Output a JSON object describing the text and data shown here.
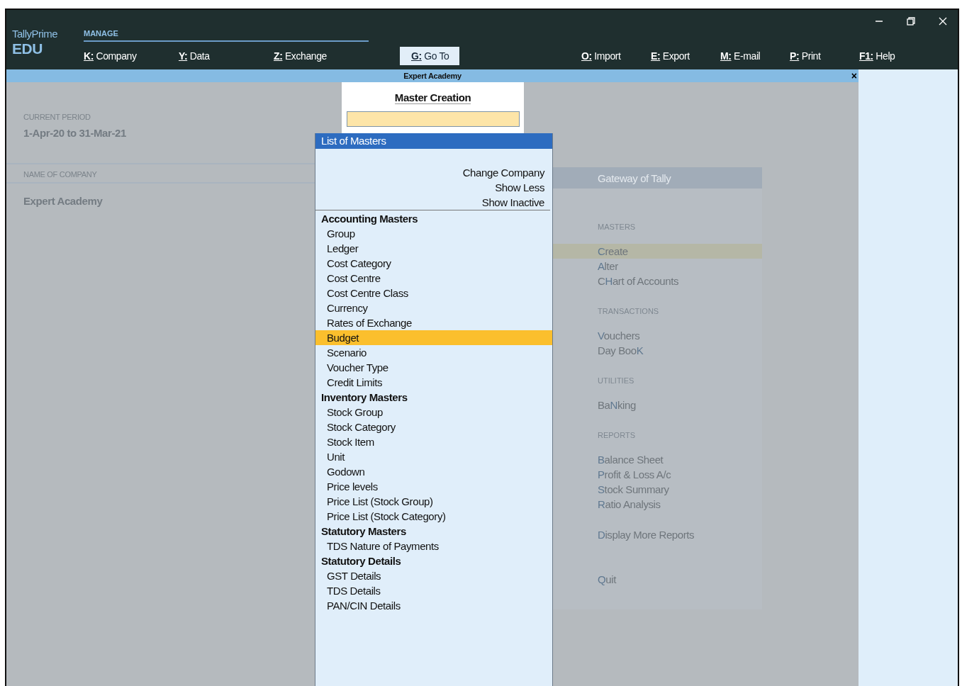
{
  "product": {
    "name": "TallyPrime",
    "edition": "EDU"
  },
  "menu_group": "MANAGE",
  "menu_left": [
    {
      "key": "K:",
      "label": "Company"
    },
    {
      "key": "Y:",
      "label": "Data"
    },
    {
      "key": "Z:",
      "label": "Exchange"
    }
  ],
  "goto_button": {
    "key": "G:",
    "label": "Go To"
  },
  "menu_right": [
    {
      "key": "O:",
      "label": "Import"
    },
    {
      "key": "E:",
      "label": "Export"
    },
    {
      "key": "M:",
      "label": "E-mail"
    },
    {
      "key": "P:",
      "label": "Print"
    },
    {
      "key": "F1:",
      "label": "Help"
    }
  ],
  "company_bar": {
    "title": "Expert Academy",
    "close": "×"
  },
  "info": [
    {
      "label": "CURRENT PERIOD",
      "value": "1-Apr-20 to 31-Mar-21"
    },
    {
      "label": "NAME OF COMPANY",
      "value": "Expert Academy"
    }
  ],
  "gateway": {
    "title": "Gateway of Tally",
    "sections": [
      {
        "title": "MASTERS",
        "items": [
          {
            "key": "C",
            "after": "reate",
            "selected": true
          },
          {
            "key": "A",
            "after": "lter",
            "selected": false
          },
          {
            "before": "C",
            "key": "H",
            "after": "art of Accounts",
            "selected": false
          }
        ]
      },
      {
        "title": "TRANSACTIONS",
        "items": [
          {
            "key": "V",
            "after": "ouchers",
            "selected": false
          },
          {
            "before": "Day Boo",
            "key": "K",
            "selected": false
          }
        ]
      },
      {
        "title": "UTILITIES",
        "items": [
          {
            "before": "Ba",
            "key": "N",
            "after": "king",
            "selected": false
          }
        ]
      },
      {
        "title": "REPORTS",
        "items": [
          {
            "key": "B",
            "after": "alance Sheet",
            "selected": false
          },
          {
            "key": "P",
            "after": "rofit & Loss A/c",
            "selected": false
          },
          {
            "key": "S",
            "after": "tock Summary",
            "selected": false
          },
          {
            "key": "R",
            "after": "atio Analysis",
            "selected": false
          }
        ]
      },
      {
        "items": [
          {
            "key": "D",
            "after": "isplay More Reports",
            "selected": false
          }
        ]
      },
      {
        "items": [
          {
            "key": "Q",
            "after": "uit",
            "selected": false
          }
        ]
      }
    ]
  },
  "master_creation": {
    "title": "Master Creation"
  },
  "list_of_masters": {
    "title": "List of Masters",
    "options": [
      "Change Company",
      "Show Less",
      "Show Inactive"
    ],
    "groups": [
      {
        "title": "Accounting Masters",
        "items": [
          {
            "label": "Group",
            "selected": false
          },
          {
            "label": "Ledger",
            "selected": false
          },
          {
            "label": "Cost Category",
            "selected": false
          },
          {
            "label": "Cost Centre",
            "selected": false
          },
          {
            "label": "Cost Centre Class",
            "selected": false
          },
          {
            "label": "Currency",
            "selected": false
          },
          {
            "label": "Rates of Exchange",
            "selected": false
          },
          {
            "label": "Budget",
            "selected": true
          },
          {
            "label": "Scenario",
            "selected": false
          },
          {
            "label": "Voucher Type",
            "selected": false
          },
          {
            "label": "Credit Limits",
            "selected": false
          }
        ]
      },
      {
        "title": "Inventory Masters",
        "items": [
          {
            "label": "Stock Group",
            "selected": false
          },
          {
            "label": "Stock Category",
            "selected": false
          },
          {
            "label": "Stock Item",
            "selected": false
          },
          {
            "label": "Unit",
            "selected": false
          },
          {
            "label": "Godown",
            "selected": false
          },
          {
            "label": "Price levels",
            "selected": false
          },
          {
            "label": "Price List (Stock Group)",
            "selected": false
          },
          {
            "label": "Price List (Stock Category)",
            "selected": false
          }
        ]
      },
      {
        "title": "Statutory Masters",
        "items": [
          {
            "label": "TDS Nature of Payments",
            "selected": false
          }
        ]
      },
      {
        "title": "Statutory Details",
        "items": [
          {
            "label": "GST Details",
            "selected": false
          },
          {
            "label": "TDS Details",
            "selected": false
          },
          {
            "label": "PAN/CIN Details",
            "selected": false
          }
        ]
      }
    ]
  }
}
